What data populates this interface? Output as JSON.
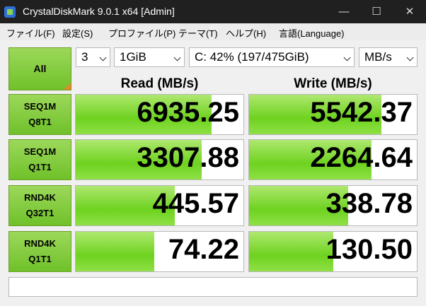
{
  "window": {
    "title": "CrystalDiskMark 9.0.1 x64 [Admin]",
    "minimize_symbol": "—",
    "maximize_symbol": "☐",
    "close_symbol": "✕"
  },
  "menu": [
    {
      "label": "ファイル(F)"
    },
    {
      "label": "設定(S)"
    },
    {
      "label": "プロファイル(P)"
    },
    {
      "label": "テーマ(T)"
    },
    {
      "label": "ヘルプ(H)"
    },
    {
      "label": "言語(Language)"
    }
  ],
  "controls": {
    "all_button": "All",
    "count": "3",
    "size": "1GiB",
    "drive": "C: 42% (197/475GiB)",
    "unit": "MB/s"
  },
  "headers": {
    "read": "Read (MB/s)",
    "write": "Write (MB/s)"
  },
  "rows": [
    {
      "line1": "SEQ1M",
      "line2": "Q8T1",
      "read": "6935.25",
      "write": "5542.37",
      "read_fill": 0.81,
      "write_fill": 0.79
    },
    {
      "line1": "SEQ1M",
      "line2": "Q1T1",
      "read": "3307.88",
      "write": "2264.64",
      "read_fill": 0.75,
      "write_fill": 0.73
    },
    {
      "line1": "RND4K",
      "line2": "Q32T1",
      "read": "445.57",
      "write": "338.78",
      "read_fill": 0.59,
      "write_fill": 0.59
    },
    {
      "line1": "RND4K",
      "line2": "Q1T1",
      "read": "74.22",
      "write": "130.50",
      "read_fill": 0.47,
      "write_fill": 0.5
    }
  ],
  "status_text": ""
}
